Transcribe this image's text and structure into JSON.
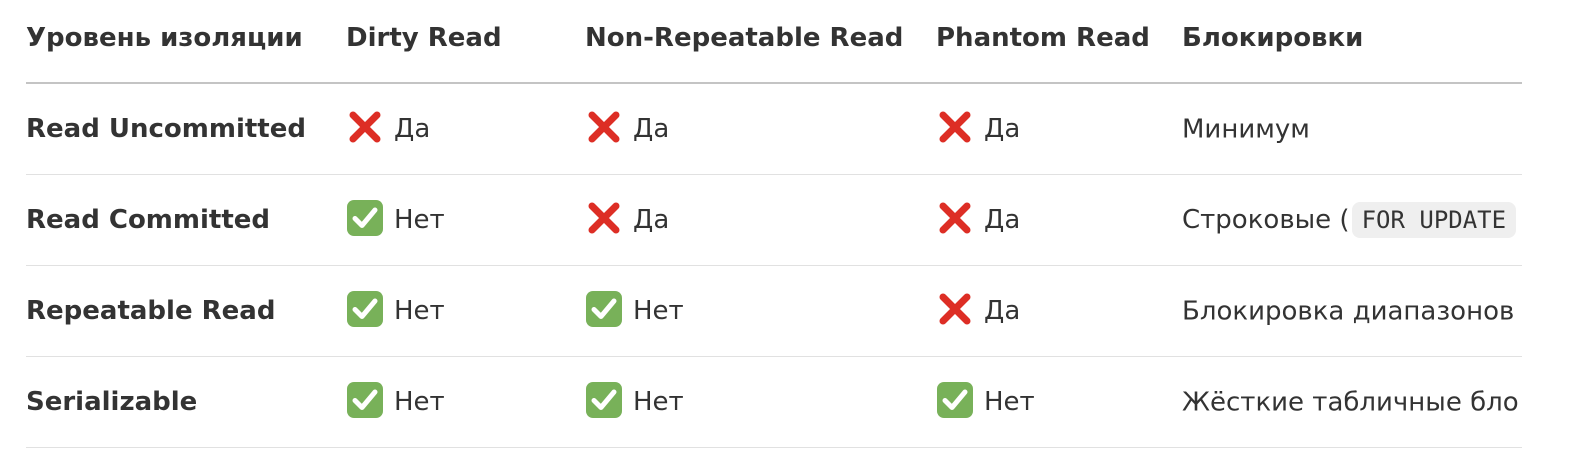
{
  "headers": [
    "Уровень изоляции",
    "Dirty Read",
    "Non-Repeatable Read",
    "Phantom Read",
    "Блокировки"
  ],
  "rows": [
    {
      "level": "Read Uncommitted",
      "dirty": {
        "icon": "cross-mark-icon",
        "text": "Да"
      },
      "nonrep": {
        "icon": "cross-mark-icon",
        "text": "Да"
      },
      "phantom": {
        "icon": "cross-mark-icon",
        "text": "Да"
      },
      "locks": "Минимум",
      "locks_code": ""
    },
    {
      "level": "Read Committed",
      "dirty": {
        "icon": "check-mark-icon",
        "text": "Нет"
      },
      "nonrep": {
        "icon": "cross-mark-icon",
        "text": "Да"
      },
      "phantom": {
        "icon": "cross-mark-icon",
        "text": "Да"
      },
      "locks": "Строковые (",
      "locks_code": "FOR UPDATE"
    },
    {
      "level": "Repeatable Read",
      "dirty": {
        "icon": "check-mark-icon",
        "text": "Нет"
      },
      "nonrep": {
        "icon": "check-mark-icon",
        "text": "Нет"
      },
      "phantom": {
        "icon": "cross-mark-icon",
        "text": "Да"
      },
      "locks": "Блокировка диапазонов",
      "locks_code": ""
    },
    {
      "level": "Serializable",
      "dirty": {
        "icon": "check-mark-icon",
        "text": "Нет"
      },
      "nonrep": {
        "icon": "check-mark-icon",
        "text": "Нет"
      },
      "phantom": {
        "icon": "check-mark-icon",
        "text": "Нет"
      },
      "locks": "Жёсткие табличные бло",
      "locks_code": ""
    }
  ],
  "colors": {
    "cross": "#dd2e25",
    "check_fill": "#78b159",
    "text": "#333333",
    "header_rule": "#c4c4c4",
    "row_rule": "#e1e1e1",
    "code_bg": "#efefef"
  }
}
